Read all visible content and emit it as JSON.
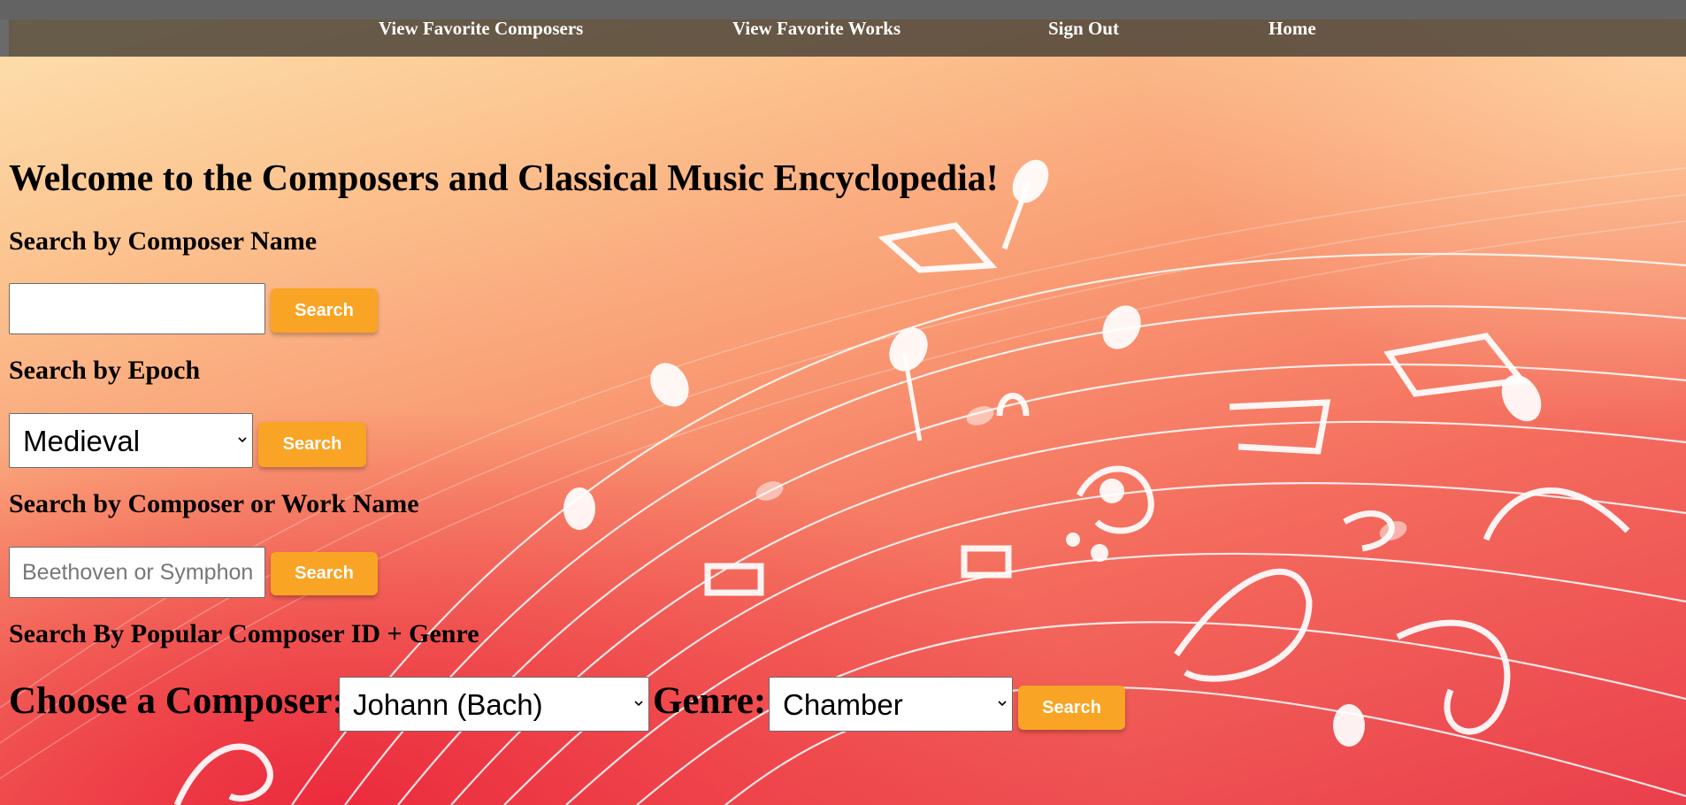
{
  "nav": {
    "items": [
      {
        "label": "View Favorite Composers"
      },
      {
        "label": "View Favorite Works"
      },
      {
        "label": "Sign Out"
      },
      {
        "label": "Home"
      }
    ]
  },
  "page": {
    "title": "Welcome to the Composers and Classical Music Encyclopedia!"
  },
  "composer_search": {
    "heading": "Search by Composer Name",
    "input_value": "",
    "button_label": "Search"
  },
  "epoch_search": {
    "heading": "Search by Epoch",
    "selected": "Medieval",
    "button_label": "Search"
  },
  "work_search": {
    "heading": "Search by Composer or Work Name",
    "placeholder": "Beethoven or Symphony",
    "button_label": "Search"
  },
  "popular_search": {
    "heading": "Search By Popular Composer ID + Genre",
    "composer_label": "Choose a Composer:",
    "composer_selected": "Johann (Bach)",
    "genre_label": "Genre:",
    "genre_selected": "Chamber",
    "button_label": "Search"
  },
  "colors": {
    "accent": "#faa425",
    "nav_bg": "#636363",
    "bg_top": "#fde3b0",
    "bg_bottom": "#ea3f4c"
  },
  "icons": {
    "select_arrow": "chevron-down-icon",
    "background_art": "music-notes-staff"
  }
}
